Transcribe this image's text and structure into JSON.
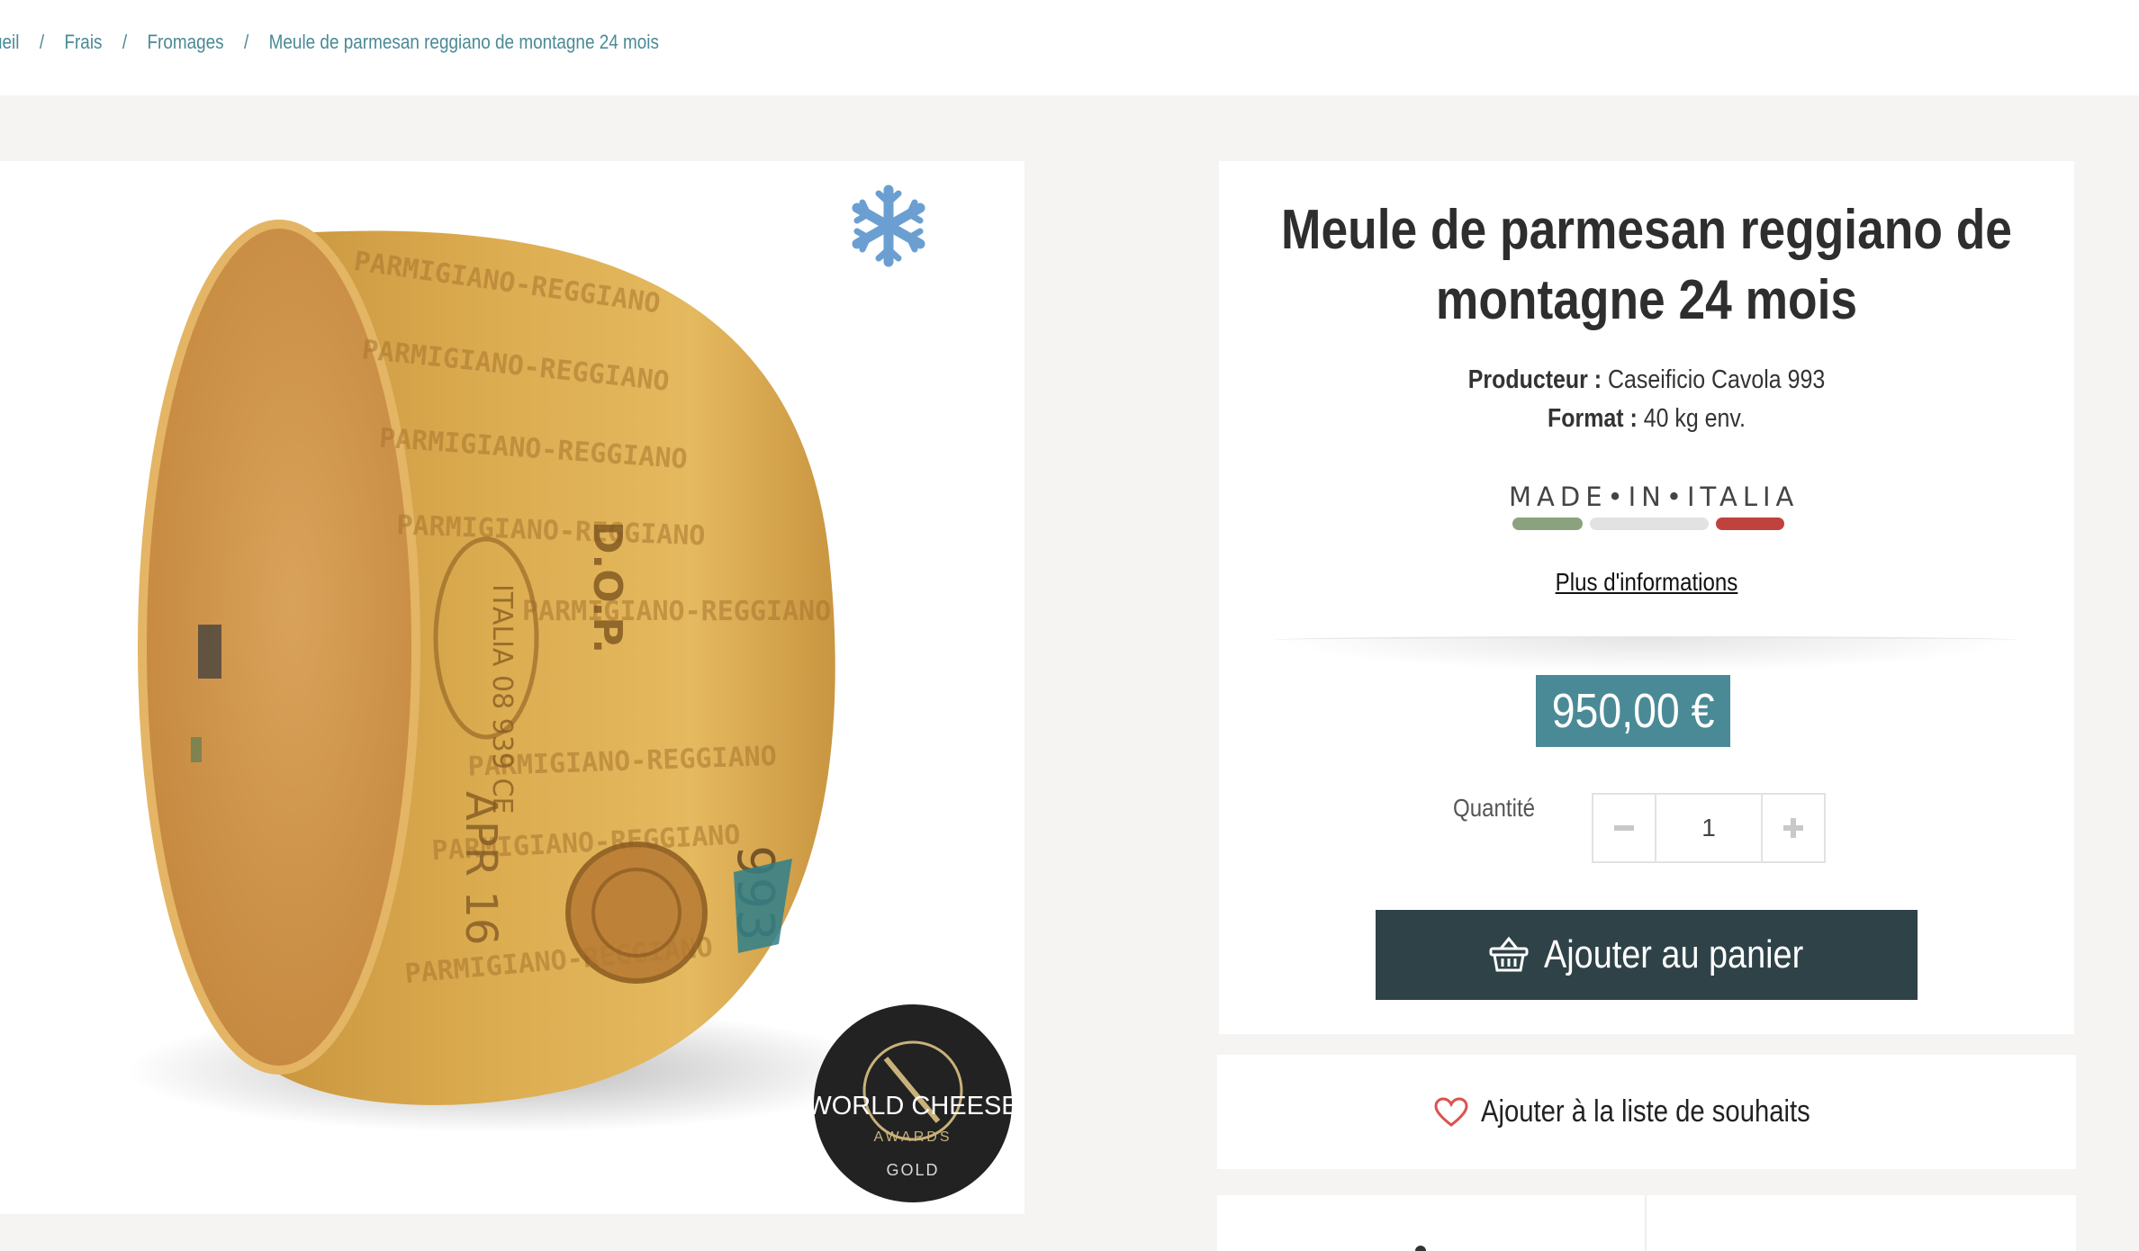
{
  "breadcrumb": {
    "items": [
      {
        "label": "ueil"
      },
      {
        "label": "Frais"
      },
      {
        "label": "Fromages"
      },
      {
        "label": "Meule de parmesan reggiano de montagne 24 mois"
      }
    ],
    "separator": "/"
  },
  "image": {
    "badge_icon": "snowflake-icon",
    "award_line1": "WORLD CHEESE",
    "award_line2": "AWARDS",
    "award_line3": "GOLD",
    "wheel_text_1": "PARMIGIANO-REGGIANO",
    "wheel_text_2": "D.O.P.",
    "wheel_text_3": "APR 16",
    "wheel_text_4": "ITALIA 08 939 CE",
    "wheel_text_5": "993"
  },
  "product": {
    "title_line1": "Meule de parmesan reggiano de",
    "title_line2": "montagne 24 mois",
    "producer_label": "Producteur :",
    "producer_value": "Caseificio Cavola 993",
    "format_label": "Format :",
    "format_value": "40 kg env.",
    "origin_logo": "MADE•IN•ITALIA",
    "more_info": "Plus d'informations",
    "price": "950,00 €",
    "quantity_label": "Quantité",
    "quantity_value": "1",
    "add_to_cart": "Ajouter au panier",
    "wishlist": "Ajouter à la liste de souhaits"
  },
  "colors": {
    "accent": "#4a8a96",
    "cart_button": "#2f4247",
    "flag_green": "#8aa37e",
    "flag_white": "#e2e2e2",
    "flag_red": "#c0423f",
    "heart": "#d9534f",
    "snowflake": "#6b9fd1"
  }
}
